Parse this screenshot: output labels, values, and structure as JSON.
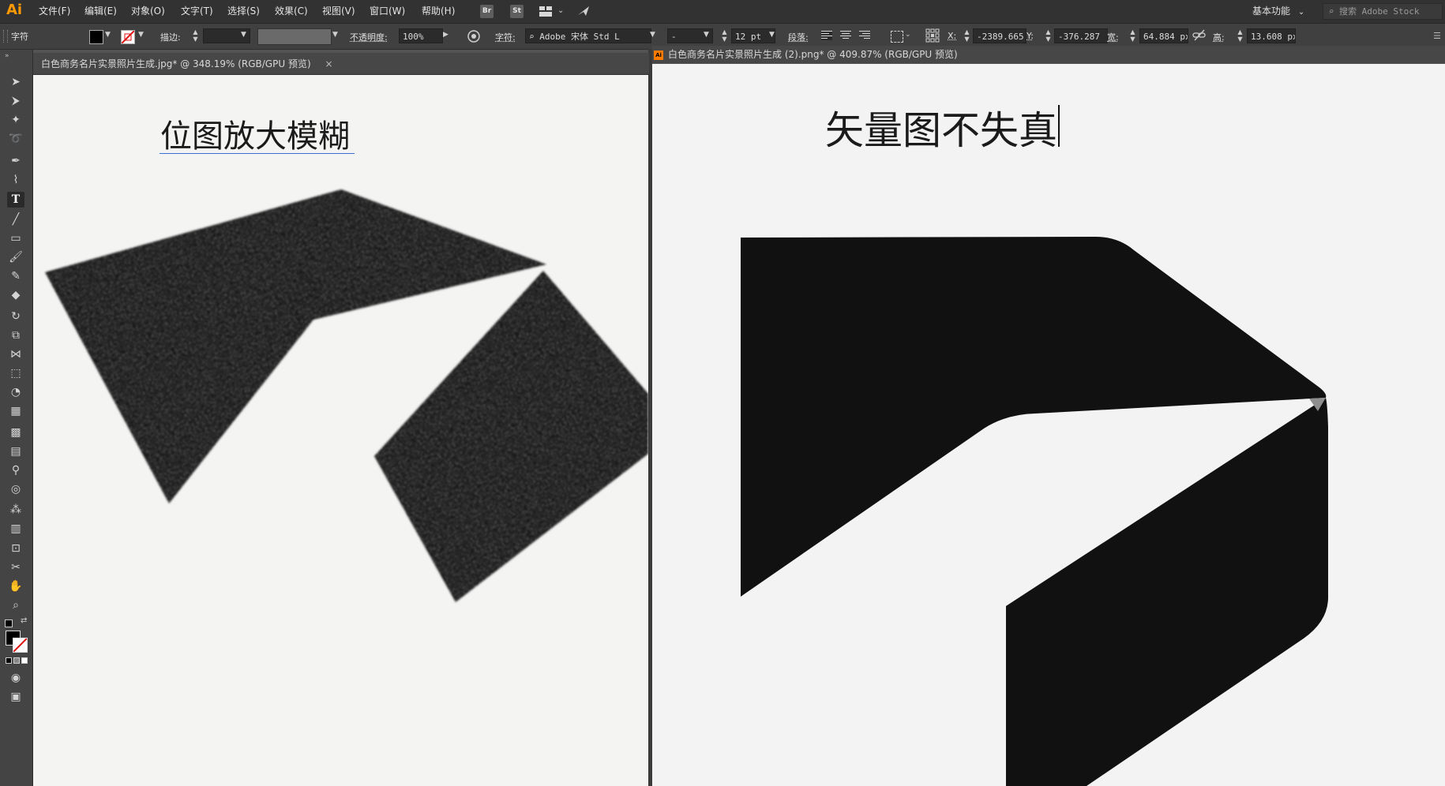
{
  "app": {
    "logo": "Ai",
    "accent": "#ff9a00"
  },
  "menu": {
    "items": [
      "文件(F)",
      "编辑(E)",
      "对象(O)",
      "文字(T)",
      "选择(S)",
      "效果(C)",
      "视图(V)",
      "窗口(W)",
      "帮助(H)"
    ],
    "bridge": "Br",
    "stock": "St",
    "workspace": "基本功能",
    "search_placeholder": "搜索 Adobe Stock"
  },
  "control_bar": {
    "panel_label": "字符",
    "stroke_label": "描边:",
    "opacity_label": "不透明度:",
    "opacity_value": "100%",
    "char_label": "字符:",
    "font_family": "Adobe 宋体 Std L",
    "font_style": "-",
    "font_size": "12 pt",
    "paragraph_label": "段落:",
    "x_label": "X:",
    "x_value": "-2389.665",
    "y_label": "Y:",
    "y_value": "-376.287",
    "w_label": "宽:",
    "w_value": "64.884 px",
    "h_label": "高:",
    "h_value": "13.608 px"
  },
  "documents": {
    "left": {
      "tab_title": "白色商务名片实景照片生成.jpg* @ 348.19% (RGB/GPU 预览)",
      "close": "×",
      "canvas_text": "位图放大模糊"
    },
    "right": {
      "tab_title": "白色商务名片实景照片生成 (2).png* @ 409.87% (RGB/GPU 预览)",
      "canvas_text": "矢量图不失真"
    }
  },
  "colors": {
    "ui_dark": "#323232",
    "canvas": "#f2f3f2",
    "shape": "#111111"
  }
}
